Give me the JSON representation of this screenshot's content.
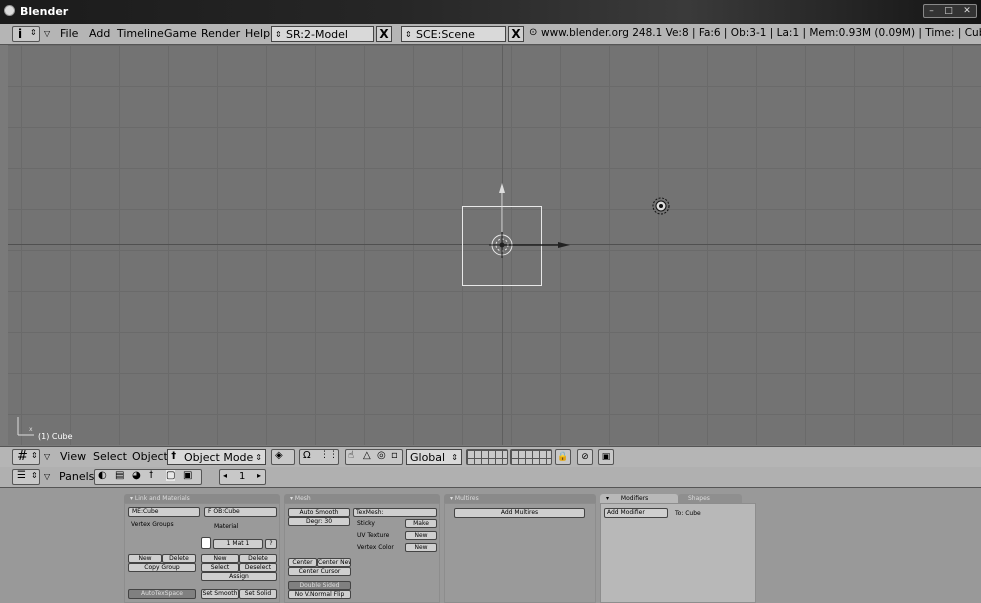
{
  "window": {
    "title": "Blender",
    "controls": [
      "–",
      "□",
      "✕"
    ]
  },
  "menu": {
    "items": [
      "File",
      "Add",
      "Timeline",
      "Game",
      "Render",
      "Help"
    ],
    "screen_field": "SR:2-Model",
    "scene_field": "SCE:Scene",
    "close_symbol": "X",
    "status": "www.blender.org 248.1  Ve:8 | Fa:6 | Ob:3-1 | La:1  | Mem:0.93M (0.09M)  | Time: | Cube"
  },
  "viewport": {
    "object_label": "(1) Cube",
    "axis_x_label": "x"
  },
  "view3d_header": {
    "menus": [
      "View",
      "Select",
      "Object"
    ],
    "mode": "Object Mode",
    "orientation": "Global"
  },
  "buttons_header": {
    "label": "Panels",
    "frame": "1"
  },
  "panels": {
    "link_materials": {
      "tab": "Link and Materials",
      "me_field": "ME:Cube",
      "f_label": "F",
      "ob_field": "OB:Cube",
      "vertex_groups": "Vertex Groups",
      "material": "Material",
      "mat_count": "1 Mat 1",
      "question": "?",
      "new1": "New",
      "delete1": "Delete",
      "copy_group": "Copy Group",
      "new2": "New",
      "delete2": "Delete",
      "select": "Select",
      "deselect": "Deselect",
      "assign": "Assign",
      "autotexspace": "AutoTexSpace",
      "set_smooth": "Set Smooth",
      "set_solid": "Set Solid"
    },
    "mesh": {
      "tab": "Mesh",
      "auto_smooth": "Auto Smooth",
      "degr": "Degr: 30",
      "texmesh": "TexMesh:",
      "sticky": "Sticky",
      "make": "Make",
      "uv_texture": "UV Texture",
      "new_uv": "New",
      "vertex_color": "Vertex Color",
      "new_vc": "New",
      "center": "Center",
      "center_new": "Center New",
      "center_cursor": "Center Cursor",
      "double_sided": "Double Sided",
      "no_vnormal_flip": "No V.Normal Flip"
    },
    "multires": {
      "tab": "Multires",
      "add": "Add Multires"
    },
    "modifiers": {
      "tab_active": "Modifiers",
      "tab_other": "Shapes",
      "add": "Add Modifier",
      "to": "To: Cube"
    }
  },
  "colors": {
    "viewport_bg": "#737373",
    "grid": "#6a6a6a",
    "header": "#b5b5b5",
    "title_bar": "#1b1b1b"
  }
}
